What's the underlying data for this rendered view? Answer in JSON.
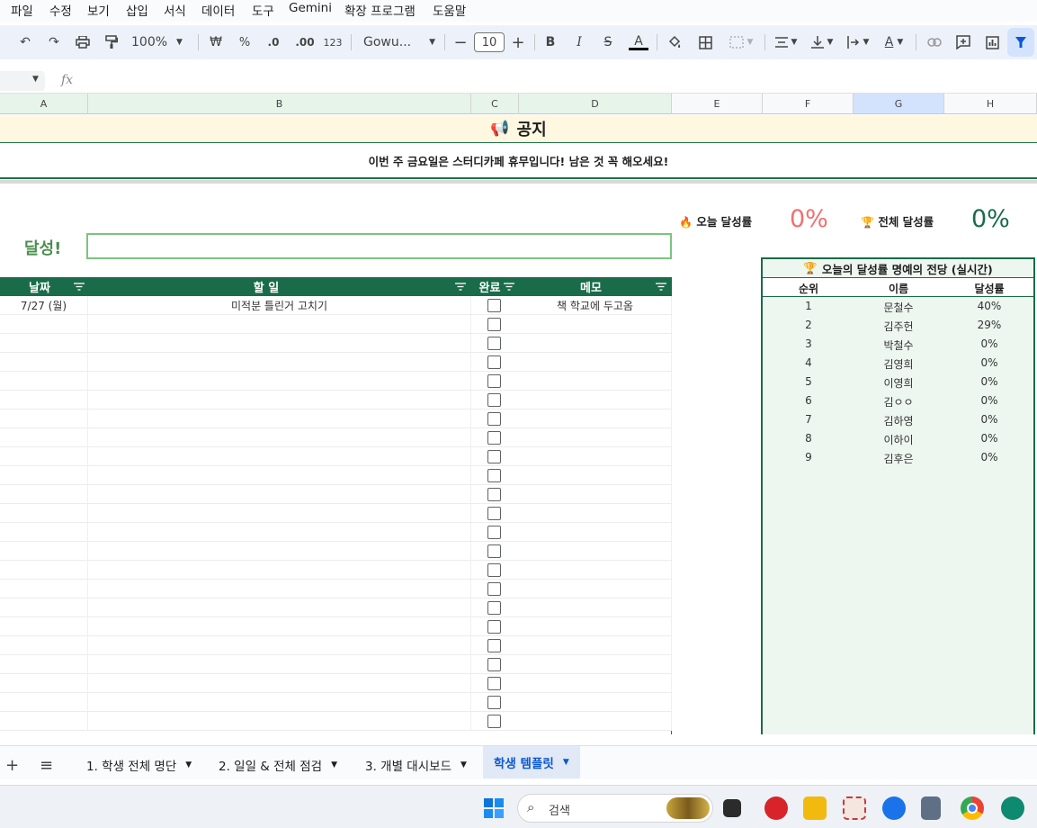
{
  "menu": [
    "파일",
    "수정",
    "보기",
    "삽입",
    "서식",
    "데이터",
    "도구",
    "Gemini",
    "확장 프로그램",
    "도움말"
  ],
  "toolbar": {
    "zoom": "100%",
    "currency": "₩",
    "percent": "%",
    "dec_less": ".0",
    "dec_more": ".00",
    "number_format": "123",
    "font": "Gowu...",
    "font_size": "10",
    "bold": "B",
    "italic": "I",
    "text_color_glyph": "A"
  },
  "formula_bar": {
    "fx": "fx",
    "value": ""
  },
  "columns": [
    "A",
    "B",
    "C",
    "D",
    "E",
    "F",
    "G",
    "H"
  ],
  "notice": {
    "emoji": "📢",
    "title": "공지",
    "body": "이번 주 금요일은 스터디카페 휴무입니다! 남은 것 꼭 해오세요!"
  },
  "achieve": {
    "label": "달성!",
    "input_value": ""
  },
  "stats": {
    "today_icon": "🔥",
    "today_label": "오늘 달성률",
    "today_value": "0%",
    "today_color": "#f07070",
    "total_icon": "🏆",
    "total_label": "전체 달성률",
    "total_value": "0%",
    "total_color": "#1a6b4a"
  },
  "task_table": {
    "headers": {
      "date": "날짜",
      "todo": "할 일",
      "done": "완료",
      "memo": "메모"
    },
    "rows": [
      {
        "date": "7/27 (월)",
        "todo": "미적분 틀린거 고치기",
        "memo": "책 학교에 두고옴"
      }
    ],
    "empty_rows": 22
  },
  "hall_of_fame": {
    "icon": "🏆",
    "title": "오늘의 달성률 명예의 전당 (실시간)",
    "headers": [
      "순위",
      "이름",
      "달성률"
    ],
    "rows": [
      [
        "1",
        "문철수",
        "40%"
      ],
      [
        "2",
        "김주헌",
        "29%"
      ],
      [
        "3",
        "박철수",
        "0%"
      ],
      [
        "4",
        "김영희",
        "0%"
      ],
      [
        "5",
        "이영희",
        "0%"
      ],
      [
        "6",
        "김ㅇㅇ",
        "0%"
      ],
      [
        "7",
        "김하영",
        "0%"
      ],
      [
        "8",
        "이하이",
        "0%"
      ],
      [
        "9",
        "김후은",
        "0%"
      ]
    ]
  },
  "sheet_tabs": {
    "add": "+",
    "all": "≡",
    "tabs": [
      "1. 학생 전체 명단",
      "2. 일일 & 전체 점검",
      "3. 개별 대시보드",
      "학생 템플릿"
    ],
    "active_index": 3
  },
  "taskbar": {
    "search_placeholder": "검색"
  },
  "colors": {
    "header_green": "#1a6b4a",
    "notice_bg": "#fff8e1",
    "hall_bg": "#eef6f0",
    "achieve_green": "#4b8f4f"
  }
}
